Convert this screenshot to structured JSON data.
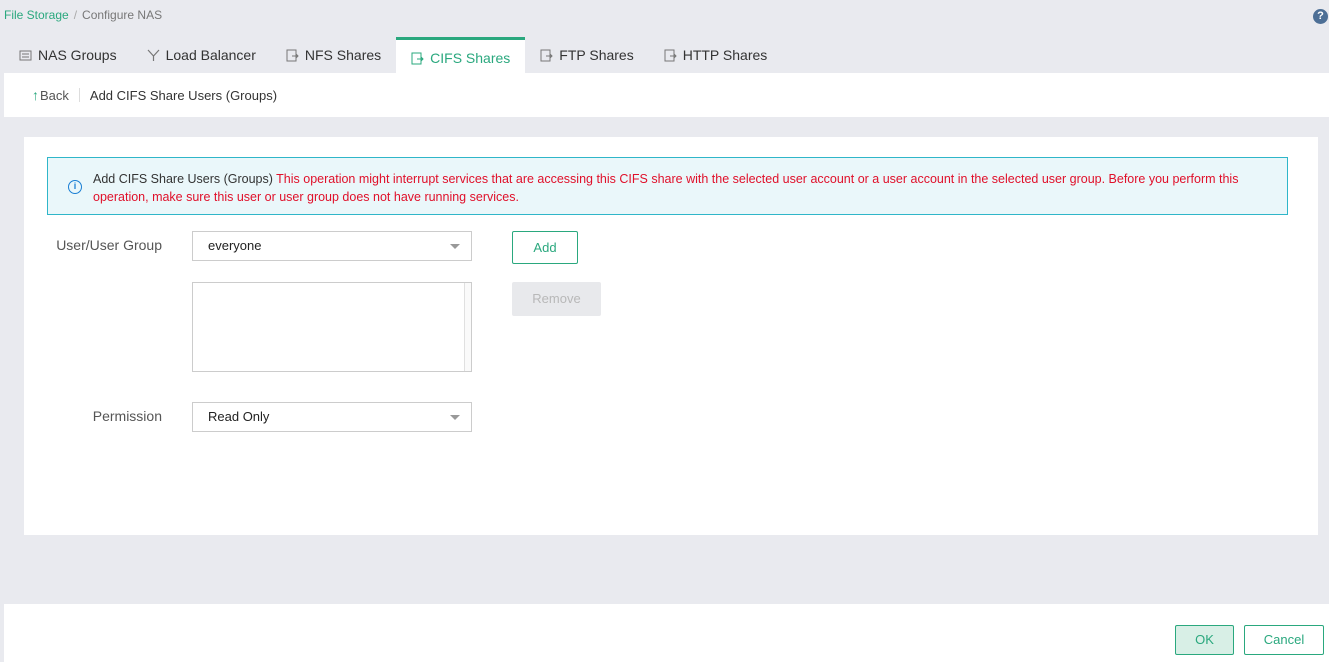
{
  "breadcrumb": {
    "root": "File Storage",
    "separator": "/",
    "current": "Configure NAS"
  },
  "help": {
    "label": "?"
  },
  "tabs": [
    {
      "label": "NAS Groups",
      "icon": "nas-groups-icon",
      "active": false
    },
    {
      "label": "Load Balancer",
      "icon": "load-balancer-icon",
      "active": false
    },
    {
      "label": "NFS Shares",
      "icon": "nfs-shares-icon",
      "active": false
    },
    {
      "label": "CIFS Shares",
      "icon": "cifs-shares-icon",
      "active": true
    },
    {
      "label": "FTP Shares",
      "icon": "ftp-shares-icon",
      "active": false
    },
    {
      "label": "HTTP Shares",
      "icon": "http-shares-icon",
      "active": false
    }
  ],
  "subheader": {
    "back_arrow": "↑",
    "back_label": "Back",
    "title": "Add CIFS Share Users (Groups)"
  },
  "notice": {
    "icon": "info-icon",
    "title": "Add CIFS Share Users (Groups)",
    "warning": "This operation might interrupt services that are accessing this CIFS share with the selected user account or a user account in the selected user group. Before you perform this operation, make sure this user or user group does not have running services."
  },
  "form": {
    "user_group_label": "User/User Group",
    "user_group_value": "everyone",
    "permission_label": "Permission",
    "permission_value": "Read Only",
    "selected_users": []
  },
  "buttons": {
    "add": "Add",
    "remove": "Remove",
    "ok": "OK",
    "cancel": "Cancel"
  },
  "colors": {
    "accent": "#2aa87e",
    "warning": "#e0102a",
    "notice_border": "#2fb6c9",
    "notice_bg": "#eaf7fa"
  }
}
